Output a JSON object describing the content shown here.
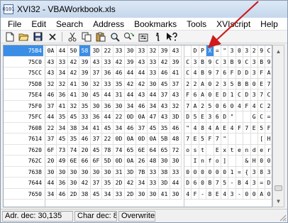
{
  "window": {
    "title": "XVI32 - VBAWorkbook.xls",
    "app_icon_text": "0101"
  },
  "menu": {
    "items": [
      "File",
      "Edit",
      "Search",
      "Address",
      "Bookmarks",
      "Tools",
      "XVIscript",
      "Help"
    ]
  },
  "toolbar": {
    "buttons": [
      {
        "name": "new-icon",
        "glyph": "🗋"
      },
      {
        "name": "open-icon",
        "glyph": "📂"
      },
      {
        "name": "save-icon",
        "glyph": "💾"
      },
      {
        "name": "close-icon",
        "glyph": "✕"
      },
      {
        "name": "cut-icon",
        "glyph": "✂"
      },
      {
        "name": "copy-icon",
        "glyph": "⎘"
      },
      {
        "name": "paste-icon",
        "glyph": "📋"
      },
      {
        "name": "find-icon",
        "glyph": "🔍"
      },
      {
        "name": "replace-icon",
        "glyph": "⟳"
      },
      {
        "name": "settings-icon",
        "glyph": "⚙"
      },
      {
        "name": "info-icon",
        "glyph": "ℹ"
      },
      {
        "name": "whats-this-icon",
        "glyph": "↖?"
      }
    ]
  },
  "hex_editor": {
    "rows": [
      {
        "addr": "75B4",
        "hex": [
          "0A",
          "44",
          "50",
          "58",
          "3D",
          "22",
          "33",
          "30",
          "33",
          "32",
          "39",
          "43"
        ],
        "text": [
          "",
          "D",
          "P",
          "X",
          "=",
          "\"",
          "3",
          "0",
          "3",
          "2",
          "9",
          "C"
        ],
        "active": true
      },
      {
        "addr": "75C0",
        "hex": [
          "43",
          "33",
          "42",
          "39",
          "43",
          "33",
          "42",
          "39",
          "43",
          "33",
          "42",
          "39"
        ],
        "text": [
          "C",
          "3",
          "B",
          "9",
          "C",
          "3",
          "B",
          "9",
          "C",
          "3",
          "B",
          "9"
        ]
      },
      {
        "addr": "75CC",
        "hex": [
          "43",
          "34",
          "42",
          "39",
          "37",
          "36",
          "46",
          "44",
          "44",
          "33",
          "46",
          "41"
        ],
        "text": [
          "C",
          "4",
          "B",
          "9",
          "7",
          "6",
          "F",
          "D",
          "D",
          "3",
          "F",
          "A"
        ]
      },
      {
        "addr": "75D8",
        "hex": [
          "32",
          "32",
          "41",
          "30",
          "32",
          "33",
          "35",
          "42",
          "42",
          "30",
          "45",
          "37"
        ],
        "text": [
          "2",
          "2",
          "A",
          "0",
          "2",
          "3",
          "5",
          "B",
          "B",
          "0",
          "E",
          "7"
        ]
      },
      {
        "addr": "75E4",
        "hex": [
          "46",
          "36",
          "41",
          "30",
          "45",
          "44",
          "31",
          "44",
          "43",
          "44",
          "37",
          "43"
        ],
        "text": [
          "F",
          "6",
          "A",
          "0",
          "E",
          "D",
          "1",
          "C",
          "D",
          "3",
          "7",
          "C"
        ]
      },
      {
        "addr": "75F0",
        "hex": [
          "37",
          "41",
          "32",
          "35",
          "30",
          "36",
          "30",
          "34",
          "46",
          "34",
          "43",
          "32"
        ],
        "text": [
          "7",
          "A",
          "2",
          "5",
          "0",
          "6",
          "0",
          "4",
          "F",
          "4",
          "C",
          "2"
        ]
      },
      {
        "addr": "75FC",
        "hex": [
          "44",
          "35",
          "45",
          "33",
          "36",
          "44",
          "22",
          "0D",
          "0A",
          "47",
          "43",
          "3D"
        ],
        "text": [
          "D",
          "5",
          "E",
          "3",
          "6",
          "D",
          "\"",
          "",
          "",
          "G",
          "C",
          "="
        ]
      },
      {
        "addr": "7608",
        "hex": [
          "22",
          "34",
          "38",
          "34",
          "41",
          "45",
          "34",
          "46",
          "37",
          "45",
          "35",
          "46"
        ],
        "text": [
          "\"",
          "4",
          "8",
          "4",
          "A",
          "E",
          "4",
          "F",
          "7",
          "E",
          "5",
          "F"
        ]
      },
      {
        "addr": "7614",
        "hex": [
          "37",
          "45",
          "35",
          "46",
          "37",
          "22",
          "0D",
          "0A",
          "0D",
          "0A",
          "5B",
          "48"
        ],
        "text": [
          "7",
          "E",
          "5",
          "F",
          "7",
          "\"",
          "",
          "",
          "",
          "",
          "[",
          "H"
        ]
      },
      {
        "addr": "7620",
        "hex": [
          "6F",
          "73",
          "74",
          "20",
          "45",
          "78",
          "74",
          "65",
          "6E",
          "64",
          "65",
          "72"
        ],
        "text": [
          "o",
          "s",
          "t",
          " ",
          "E",
          "x",
          "t",
          "e",
          "n",
          "d",
          "e",
          "r"
        ]
      },
      {
        "addr": "762C",
        "hex": [
          "20",
          "49",
          "6E",
          "66",
          "6F",
          "5D",
          "0D",
          "0A",
          "26",
          "48",
          "30",
          "30"
        ],
        "text": [
          " ",
          "I",
          "n",
          "f",
          "o",
          "]",
          "",
          "",
          "&",
          "H",
          "0",
          "0"
        ]
      },
      {
        "addr": "7638",
        "hex": [
          "30",
          "30",
          "30",
          "30",
          "30",
          "30",
          "31",
          "3D",
          "7B",
          "33",
          "38",
          "33"
        ],
        "text": [
          "0",
          "0",
          "0",
          "0",
          "0",
          "0",
          "1",
          "=",
          "{",
          "3",
          "8",
          "3"
        ]
      },
      {
        "addr": "7644",
        "hex": [
          "44",
          "36",
          "30",
          "42",
          "37",
          "35",
          "2D",
          "42",
          "34",
          "33",
          "3D",
          "44"
        ],
        "text": [
          "D",
          "6",
          "0",
          "B",
          "7",
          "5",
          "-",
          "B",
          "4",
          "3",
          "=",
          "D"
        ]
      },
      {
        "addr": "7650",
        "hex": [
          "34",
          "46",
          "2D",
          "38",
          "45",
          "34",
          "33",
          "2D",
          "30",
          "30",
          "41",
          "30"
        ],
        "text": [
          "4",
          "F",
          "-",
          "8",
          "E",
          "4",
          "3",
          "-",
          "0",
          "0",
          "A",
          "0"
        ]
      }
    ],
    "selected_row": 0,
    "selected_col": 3
  },
  "scrollbar": {
    "up_glyph": "▲",
    "down_glyph": "▼",
    "position": 0.97
  },
  "status": {
    "address": "Adr. dec: 30,135",
    "char": "Char dec: 88",
    "mode": "Overwrite"
  },
  "colors": {
    "selection": "#3a8ee6",
    "annotation_arrow": "#d11a1a"
  }
}
